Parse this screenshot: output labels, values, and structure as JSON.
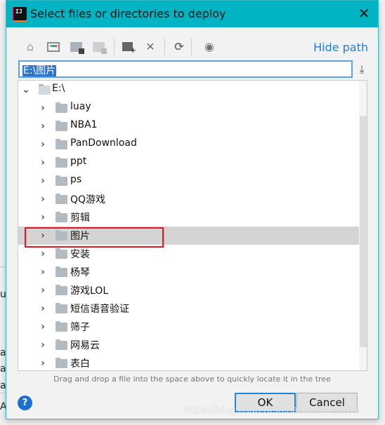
{
  "background_window": {
    "fragments": [
      "u",
      "a",
      "a",
      "a",
      "A"
    ]
  },
  "dialog": {
    "title": "Select files or directories to deploy",
    "accent_color": "#00b4c4",
    "toolbar": {
      "icons": [
        "home-icon",
        "desktop-icon",
        "project-folder-icon",
        "module-folder-icon",
        "new-folder-icon",
        "delete-icon",
        "refresh-icon",
        "show-hidden-icon"
      ],
      "hide_path_label": "Hide path"
    },
    "path_value": "E:\\图片",
    "tree": {
      "root": "E:\\",
      "items": [
        {
          "label": "luay"
        },
        {
          "label": "NBA1"
        },
        {
          "label": "PanDownload"
        },
        {
          "label": "ppt"
        },
        {
          "label": "ps"
        },
        {
          "label": "QQ游戏"
        },
        {
          "label": "剪辑"
        },
        {
          "label": "图片",
          "selected": true
        },
        {
          "label": "安装"
        },
        {
          "label": "杨琴"
        },
        {
          "label": "游戏LOL"
        },
        {
          "label": "短信语音验证"
        },
        {
          "label": "筛子"
        },
        {
          "label": "网易云"
        },
        {
          "label": "表白"
        }
      ],
      "scroll_position": 0.12,
      "scroll_visible_fraction": 0.8,
      "highlight_color": "#e0181e"
    },
    "hint": "Drag and drop a file into the space above to quickly locate it in the tree",
    "help_label": "?",
    "ok_label": "OK",
    "cancel_label": "Cancel"
  },
  "watermark": "https://blog.csdn.net/chenbowenleave"
}
